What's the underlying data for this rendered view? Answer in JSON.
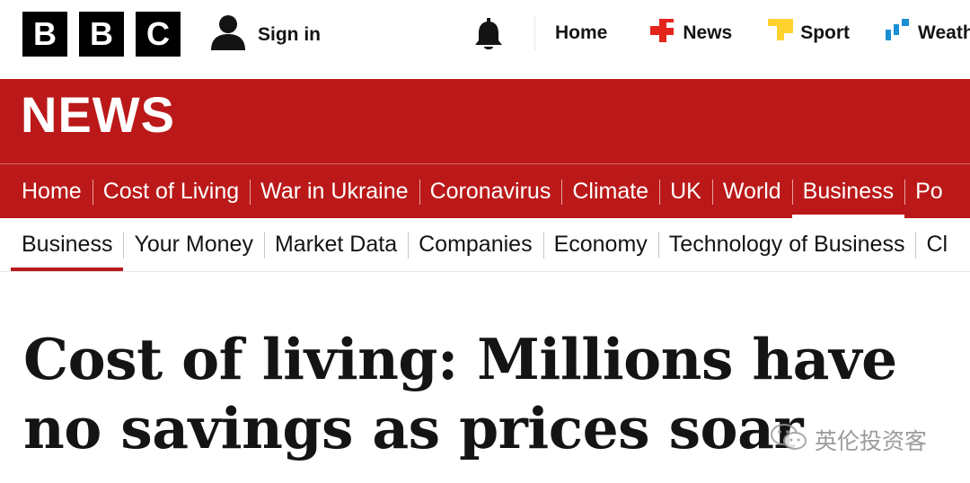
{
  "brand": {
    "logo_letters": [
      "B",
      "B",
      "C"
    ]
  },
  "topbar": {
    "sign_in": "Sign in",
    "links": [
      {
        "label": "Home",
        "icon": "none"
      },
      {
        "label": "News",
        "icon": "news-icon",
        "color": "#e3251c"
      },
      {
        "label": "Sport",
        "icon": "sport-icon",
        "color": "#ffd230"
      },
      {
        "label": "Weath",
        "icon": "weather-icon",
        "color": "#1a8fd0"
      }
    ]
  },
  "banner": {
    "title": "NEWS",
    "background": "#bb1919"
  },
  "primary_nav": {
    "items": [
      "Home",
      "Cost of Living",
      "War in Ukraine",
      "Coronavirus",
      "Climate",
      "UK",
      "World",
      "Business",
      "Po"
    ],
    "active": "Business"
  },
  "secondary_nav": {
    "items": [
      "Business",
      "Your Money",
      "Market Data",
      "Companies",
      "Economy",
      "Technology of Business",
      "Cl"
    ],
    "active": "Business"
  },
  "article": {
    "headline": "Cost of living: Millions have no savings as prices soar"
  },
  "watermark": {
    "text": "英伦投资客"
  }
}
